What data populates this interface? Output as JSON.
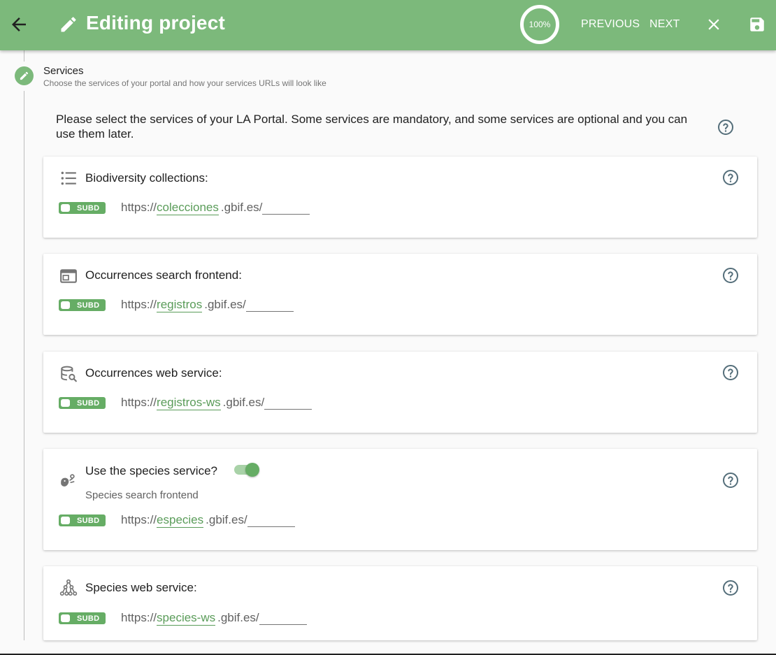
{
  "header": {
    "title": "Editing project",
    "progress": "100%",
    "progress_value": 100,
    "previous_label": "PREVIOUS",
    "next_label": "NEXT",
    "accent_color": "#7cb97b"
  },
  "step": {
    "title": "Services",
    "subtitle": "Choose the services of your portal and how your services URLs will look like"
  },
  "intro_text": "Please select the services of your LA Portal. Some services are mandatory, and some services are optional and you can use them later.",
  "services": [
    {
      "label": "Biodiversity collections:",
      "icon": "list-icon",
      "toggle_label": "SUBD",
      "url_prefix": "https://",
      "subdomain": "colecciones",
      "domain": ".gbif.es/"
    },
    {
      "label": "Occurrences search frontend:",
      "icon": "web-window-icon",
      "toggle_label": "SUBD",
      "url_prefix": "https://",
      "subdomain": "registros",
      "domain": ".gbif.es/"
    },
    {
      "label": "Occurrences web service:",
      "icon": "database-search-icon",
      "toggle_label": "SUBD",
      "url_prefix": "https://",
      "subdomain": "registros-ws",
      "domain": ".gbif.es/"
    },
    {
      "label": "Use the species service?",
      "sublabel": "Species search frontend",
      "icon": "species-icon",
      "enabled": true,
      "toggle_label": "SUBD",
      "url_prefix": "https://",
      "subdomain": "especies",
      "domain": ".gbif.es/"
    },
    {
      "label": "Species web service:",
      "icon": "hierarchy-icon",
      "toggle_label": "SUBD",
      "url_prefix": "https://",
      "subdomain": "species-ws",
      "domain": ".gbif.es/"
    }
  ]
}
